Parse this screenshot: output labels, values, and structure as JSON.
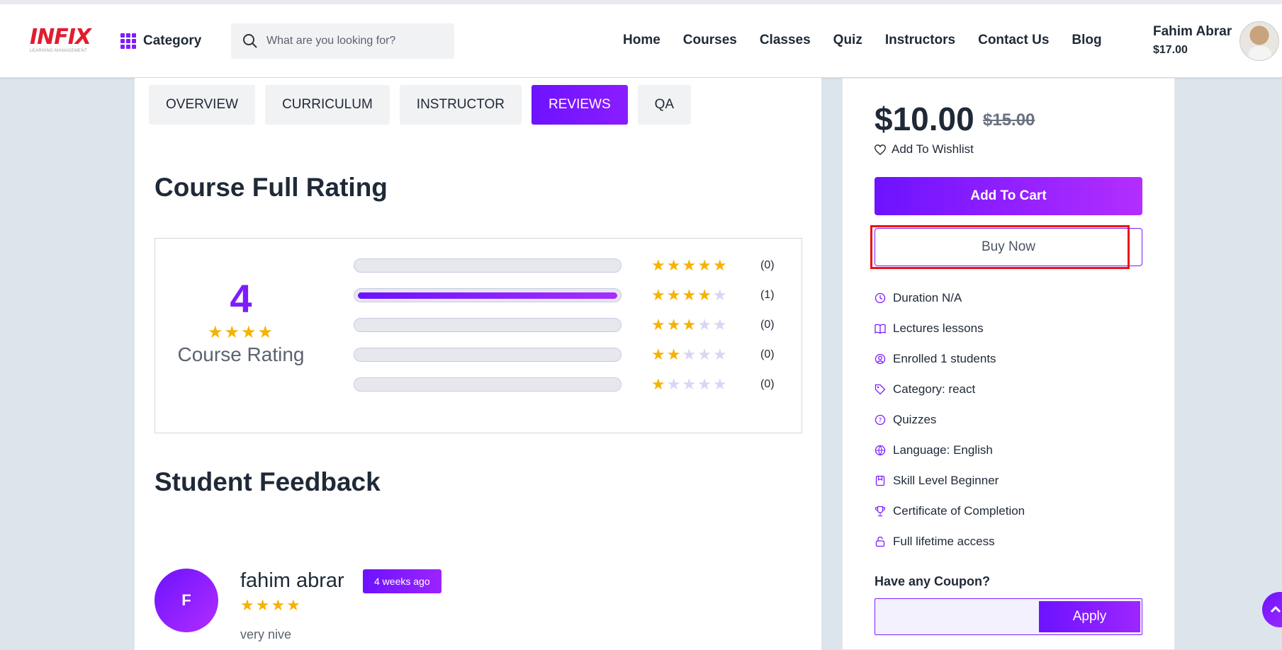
{
  "brand": {
    "logo_text": "INFIX",
    "logo_subtitle": "LEARNING MANAGEMENT",
    "accent": "#7c1dff",
    "logo_color": "#e11d2e"
  },
  "header": {
    "category_label": "Category",
    "search_placeholder": "What are you looking for?",
    "nav": [
      "Home",
      "Courses",
      "Classes",
      "Quiz",
      "Instructors",
      "Contact Us",
      "Blog"
    ],
    "user_name": "Fahim Abrar",
    "user_balance": "$17.00"
  },
  "tabs": [
    {
      "label": "OVERVIEW",
      "active": false
    },
    {
      "label": "CURRICULUM",
      "active": false
    },
    {
      "label": "INSTRUCTOR",
      "active": false
    },
    {
      "label": "REVIEWS",
      "active": true
    },
    {
      "label": "QA",
      "active": false
    }
  ],
  "rating": {
    "title": "Course Full Rating",
    "average": "4",
    "average_stars": "★★★★",
    "label": "Course Rating",
    "rows": [
      {
        "stars": 5,
        "count": "(0)",
        "fill": 0
      },
      {
        "stars": 4,
        "count": "(1)",
        "fill": 1
      },
      {
        "stars": 3,
        "count": "(0)",
        "fill": 0
      },
      {
        "stars": 2,
        "count": "(0)",
        "fill": 0
      },
      {
        "stars": 1,
        "count": "(0)",
        "fill": 0
      }
    ]
  },
  "feedback": {
    "title": "Student Feedback",
    "reviews": [
      {
        "initial": "F",
        "name": "fahim abrar",
        "time": "4 weeks ago",
        "stars": "★★★★",
        "text": "very nive"
      }
    ]
  },
  "sidebar": {
    "price": "$10.00",
    "old_price": "$15.00",
    "wishlist": "Add To Wishlist",
    "add_to_cart": "Add To Cart",
    "buy_now": "Buy Now",
    "features": [
      {
        "icon": "clock-icon",
        "text": "Duration N/A"
      },
      {
        "icon": "book-icon",
        "text": "Lectures lessons"
      },
      {
        "icon": "user-icon",
        "text": "Enrolled 1 students"
      },
      {
        "icon": "tag-icon",
        "text": "Category: react"
      },
      {
        "icon": "quiz-icon",
        "text": "Quizzes"
      },
      {
        "icon": "language-icon",
        "text": " Language: English"
      },
      {
        "icon": "level-icon",
        "text": "Skill Level Beginner"
      },
      {
        "icon": "trophy-icon",
        "text": "Certificate of Completion"
      },
      {
        "icon": "lock-icon",
        "text": "Full lifetime access"
      }
    ],
    "coupon_label": "Have any Coupon?",
    "coupon_value": "",
    "apply": "Apply"
  }
}
